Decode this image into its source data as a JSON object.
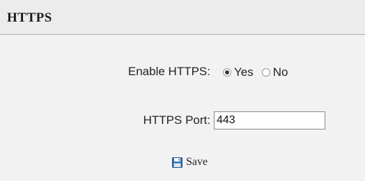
{
  "header": {
    "title": "HTTPS"
  },
  "form": {
    "enable_https": {
      "label": "Enable HTTPS:",
      "options": [
        {
          "label": "Yes",
          "selected": true
        },
        {
          "label": "No",
          "selected": false
        }
      ]
    },
    "https_port": {
      "label": "HTTPS Port:",
      "value": "443"
    },
    "save": {
      "label": "Save",
      "icon": "floppy-disk-icon"
    }
  },
  "colors": {
    "background": "#f2f2f2",
    "header_background": "#ececec",
    "icon_accent": "#2f6fb5"
  }
}
